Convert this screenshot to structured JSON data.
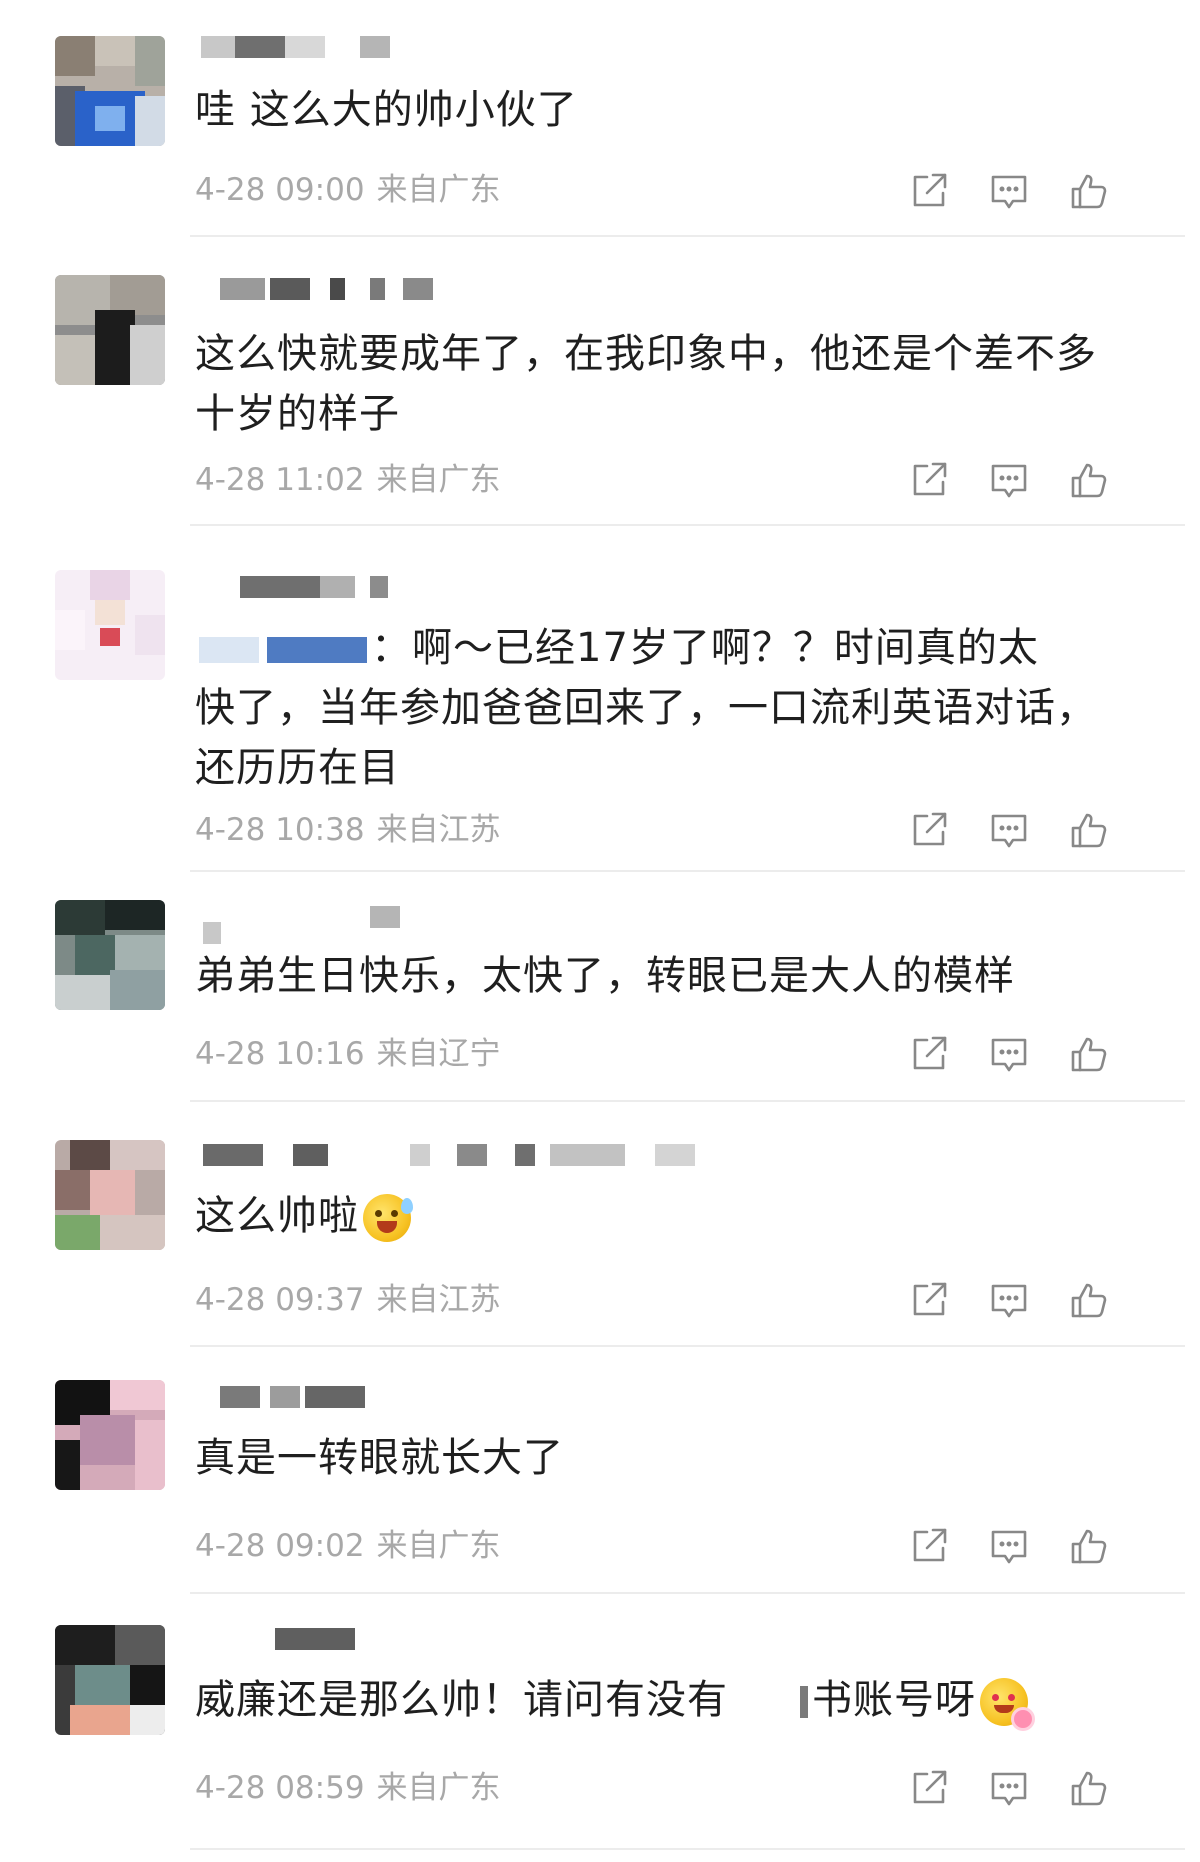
{
  "comments": [
    {
      "username": "",
      "text": "哇 这么大的帅小伙了",
      "time": "4-28 09:00",
      "location": "来自广东"
    },
    {
      "username": "",
      "text_lines": [
        "这么快就要成年了，在我印象中，他还是个差不多",
        "十岁的样子"
      ],
      "time": "4-28 11:02",
      "location": "来自广东"
    },
    {
      "username": "",
      "text_lines": [
        "：啊～已经17岁了啊？？时间真的太",
        "快了，当年参加爸爸回来了，一口流利英语对话，",
        "还历历在目"
      ],
      "time": "4-28 10:38",
      "location": "来自江苏"
    },
    {
      "username": "",
      "text": "弟弟生日快乐，太快了，转眼已是大人的模样",
      "time": "4-28 10:16",
      "location": "来自辽宁"
    },
    {
      "username": "",
      "text": "这么帅啦",
      "time": "4-28 09:37",
      "location": "来自江苏"
    },
    {
      "username": "",
      "text": "真是一转眼就长大了",
      "time": "4-28 09:02",
      "location": "来自广东"
    },
    {
      "username": "",
      "text_before": "威廉还是那么帅！请问有没有",
      "text_after": "书账号呀",
      "time": "4-28 08:59",
      "location": "来自广东"
    }
  ],
  "icons": {
    "share": "share-icon",
    "reply": "comment-icon",
    "like": "thumbs-up-icon"
  },
  "colors": {
    "text": "#1f1f1f",
    "meta": "#a8a8a8",
    "icon": "#888888",
    "divider": "#ececec"
  }
}
